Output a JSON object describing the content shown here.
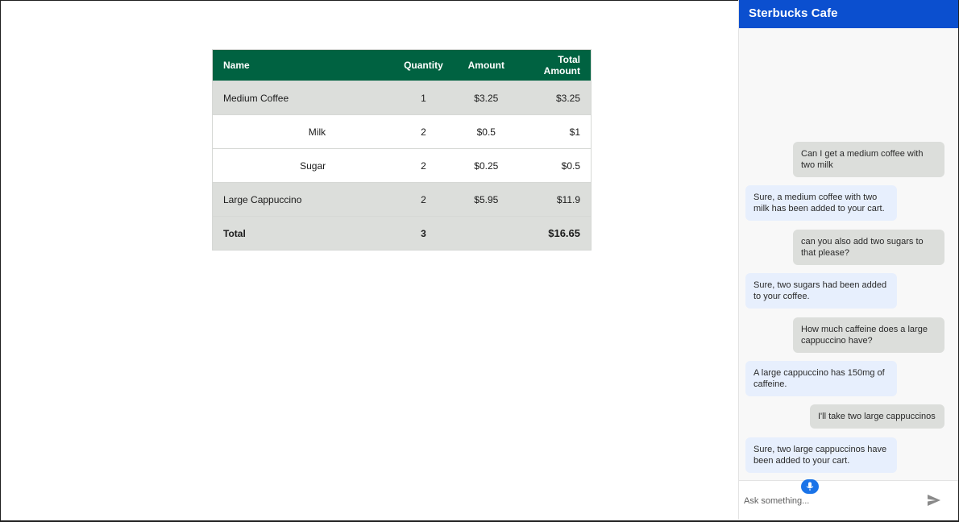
{
  "order_table": {
    "headers": {
      "name": "Name",
      "quantity": "Quantity",
      "amount": "Amount",
      "total_amount": "Total Amount"
    },
    "rows": [
      {
        "name": "Medium Coffee",
        "quantity": "1",
        "amount": "$3.25",
        "total": "$3.25"
      },
      {
        "name": "Milk",
        "quantity": "2",
        "amount": "$0.5",
        "total": "$1"
      },
      {
        "name": "Sugar",
        "quantity": "2",
        "amount": "$0.25",
        "total": "$0.5"
      },
      {
        "name": "Large Cappuccino",
        "quantity": "2",
        "amount": "$5.95",
        "total": "$11.9"
      }
    ],
    "total": {
      "label": "Total",
      "quantity": "3",
      "total": "$16.65"
    }
  },
  "chat": {
    "title": "Sterbucks Cafe",
    "messages": [
      {
        "from": "user",
        "text": "Can I get a medium coffee with two milk"
      },
      {
        "from": "bot",
        "text": "Sure, a medium coffee with two milk has been added to your cart."
      },
      {
        "from": "user",
        "text": "can you also add two sugars to that please?"
      },
      {
        "from": "bot",
        "text": "Sure, two sugars had been added to your coffee."
      },
      {
        "from": "user",
        "text": "How much caffeine does a large cappuccino have?"
      },
      {
        "from": "bot",
        "text": "A large cappuccino has 150mg of caffeine."
      },
      {
        "from": "user",
        "text": "I'll take two large cappuccinos"
      },
      {
        "from": "bot",
        "text": "Sure, two large cappuccinos have been added to your cart."
      }
    ],
    "input_placeholder": "Ask something...",
    "input_value": "",
    "icons": {
      "mic": "microphone-icon",
      "send": "send-icon"
    },
    "colors": {
      "header": "#0b4fcf",
      "user_bubble": "#dcdedb",
      "bot_bubble": "#e7effd",
      "mic": "#1a73e8"
    }
  },
  "colors": {
    "table_header": "#006241",
    "table_highlight_row": "#dcdedb"
  }
}
